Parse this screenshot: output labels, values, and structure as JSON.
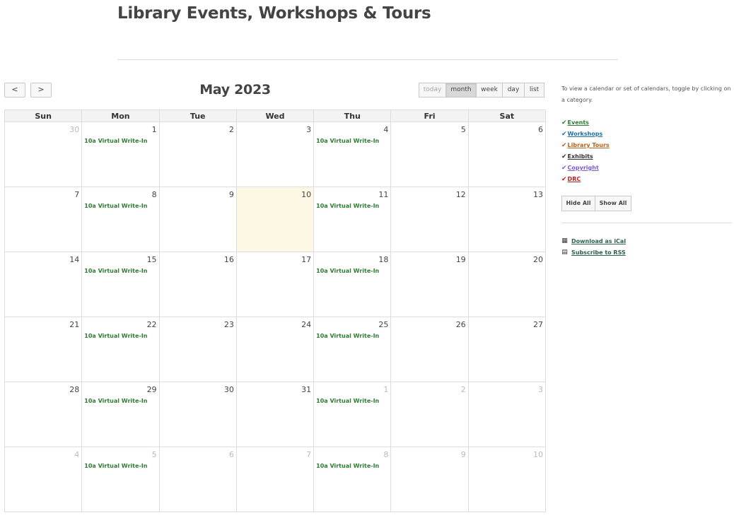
{
  "page": {
    "title": "Library Events, Workshops & Tours"
  },
  "toolbar": {
    "prev_label": "<",
    "next_label": ">",
    "title": "May 2023",
    "views": [
      {
        "label": "today",
        "state": "disabled"
      },
      {
        "label": "month",
        "state": "active"
      },
      {
        "label": "week",
        "state": "normal"
      },
      {
        "label": "day",
        "state": "normal"
      },
      {
        "label": "list",
        "state": "normal"
      }
    ]
  },
  "calendar": {
    "weekdays": [
      "Sun",
      "Mon",
      "Tue",
      "Wed",
      "Thu",
      "Fri",
      "Sat"
    ],
    "event_label": "10a Virtual Write-In",
    "event_color": "#2e7d32",
    "today_color": "#fcf8e3",
    "weeks": [
      [
        {
          "day": "30",
          "other": true
        },
        {
          "day": "1",
          "event": "10a Virtual Write-In"
        },
        {
          "day": "2"
        },
        {
          "day": "3"
        },
        {
          "day": "4",
          "event": "10a Virtual Write-In"
        },
        {
          "day": "5"
        },
        {
          "day": "6"
        }
      ],
      [
        {
          "day": "7"
        },
        {
          "day": "8",
          "event": "10a Virtual Write-In"
        },
        {
          "day": "9"
        },
        {
          "day": "10",
          "today": true
        },
        {
          "day": "11",
          "event": "10a Virtual Write-In"
        },
        {
          "day": "12"
        },
        {
          "day": "13"
        }
      ],
      [
        {
          "day": "14"
        },
        {
          "day": "15",
          "event": "10a Virtual Write-In"
        },
        {
          "day": "16"
        },
        {
          "day": "17"
        },
        {
          "day": "18",
          "event": "10a Virtual Write-In"
        },
        {
          "day": "19"
        },
        {
          "day": "20"
        }
      ],
      [
        {
          "day": "21"
        },
        {
          "day": "22",
          "event": "10a Virtual Write-In"
        },
        {
          "day": "23"
        },
        {
          "day": "24"
        },
        {
          "day": "25",
          "event": "10a Virtual Write-In"
        },
        {
          "day": "26"
        },
        {
          "day": "27"
        }
      ],
      [
        {
          "day": "28"
        },
        {
          "day": "29",
          "event": "10a Virtual Write-In"
        },
        {
          "day": "30"
        },
        {
          "day": "31"
        },
        {
          "day": "1",
          "other": true,
          "event": "10a Virtual Write-In"
        },
        {
          "day": "2",
          "other": true
        },
        {
          "day": "3",
          "other": true
        }
      ],
      [
        {
          "day": "4",
          "other": true
        },
        {
          "day": "5",
          "other": true,
          "event": "10a Virtual Write-In"
        },
        {
          "day": "6",
          "other": true
        },
        {
          "day": "7",
          "other": true
        },
        {
          "day": "8",
          "other": true,
          "event": "10a Virtual Write-In"
        },
        {
          "day": "9",
          "other": true
        },
        {
          "day": "10",
          "other": true
        }
      ]
    ]
  },
  "sidebar": {
    "help_text": "To view a calendar or set of calendars, toggle by clicking on a category.",
    "categories": [
      {
        "label": "Events",
        "color": "#2e7d32"
      },
      {
        "label": "Workshops",
        "color": "#1f6fa8"
      },
      {
        "label": "Library Tours",
        "color": "#b8621b"
      },
      {
        "label": "Exhibits",
        "color": "#333333"
      },
      {
        "label": "Copyright",
        "color": "#7b5ccf"
      },
      {
        "label": "DRC",
        "color": "#b22222"
      }
    ],
    "hide_all_label": "Hide All",
    "show_all_label": "Show All",
    "ical_label": "Download as iCal",
    "ical_icon": "calendar-icon",
    "rss_label": "Subscribe to RSS",
    "rss_icon": "rss-icon"
  }
}
